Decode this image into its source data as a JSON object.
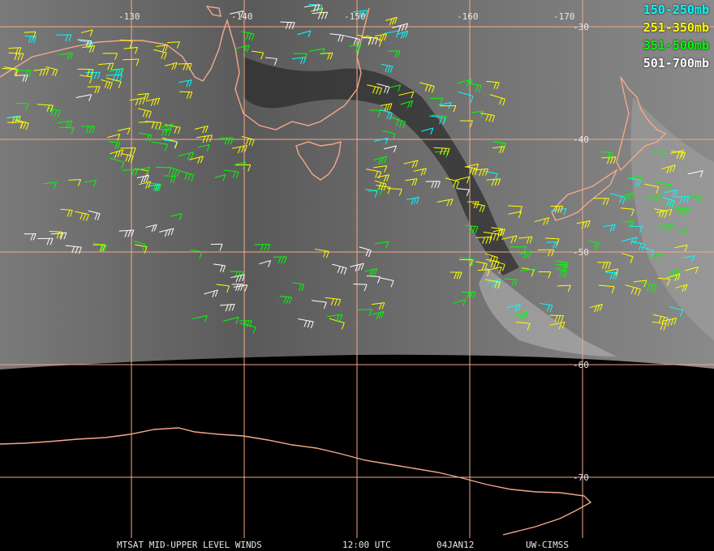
{
  "legend": [
    {
      "label": "150-250mb",
      "color": "#00ffff"
    },
    {
      "label": "251-350mb",
      "color": "#ffff00"
    },
    {
      "label": "351-500mb",
      "color": "#00ff00"
    },
    {
      "label": "501-700mb",
      "color": "#ffffff"
    }
  ],
  "axes": {
    "longitude_labels": [
      "-130",
      "-140",
      "-150",
      "-160",
      "-170"
    ],
    "latitude_labels": [
      "-30",
      "-40",
      "-50",
      "-60",
      "-70"
    ]
  },
  "footer": {
    "product": "MTSAT MID-UPPER LEVEL WINDS",
    "time": "12:00 UTC",
    "date": "04JAN12",
    "source": "UW-CIMSS"
  },
  "colors": {
    "coastline": "#f4a98a",
    "grid": "#f4a98a",
    "background_dark": "#000000"
  }
}
